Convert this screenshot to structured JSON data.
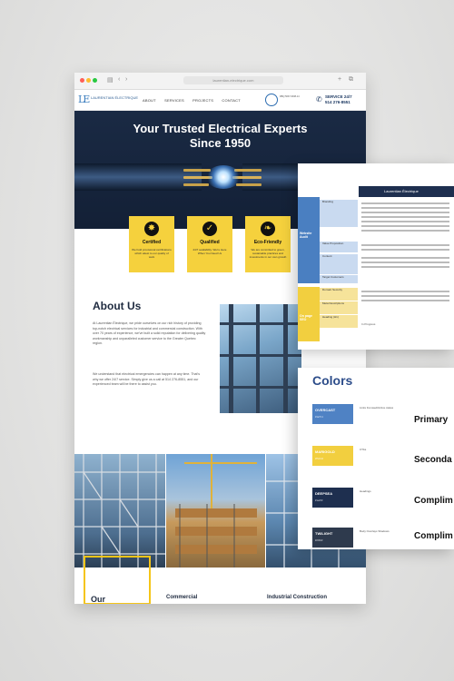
{
  "browser": {
    "url": "laurentian-electrique.com",
    "nav_icons": [
      "sidebar-icon",
      "back-icon",
      "forward-icon",
      "share-icon",
      "new-tab-icon",
      "tabs-icon"
    ]
  },
  "site": {
    "logo_mark": "LE",
    "logo_text_1": "LAURENTIAN ÉLECTRIQUE",
    "logo_text_2": "",
    "nav": [
      "ABOUT",
      "SERVICES",
      "PROJECTS",
      "CONTACT"
    ],
    "badge_text": "RBQ 5637-6038-14",
    "service_label": "SERVICE 24/7",
    "phone": "514 276-8551"
  },
  "hero": {
    "title_1": "Your Trusted Electrical Experts",
    "title_2": "Since 1950"
  },
  "features": [
    {
      "icon": "certified-icon",
      "glyph": "✸",
      "title": "Certified",
      "desc": "We hold provisional certifications which attest to our quality of work"
    },
    {
      "icon": "check-icon",
      "glyph": "✓",
      "title": "Qualified",
      "desc": "24/7 availability. We're Here When You Need Us"
    },
    {
      "icon": "leaf-icon",
      "glyph": "❧",
      "title": "Eco-Friendly",
      "desc": "We are committed to green, sustainable practices and investments in our own growth"
    }
  ],
  "about": {
    "heading": "About Us",
    "p1": "At Laurentian Électrique, we pride ourselves on our rich history of providing top-notch electrical services for industrial and commercial construction. With over 70 years of experience, we've built a solid reputation for delivering quality workmanship and unparalleled customer service to the Greater Quebec region.",
    "p2": "We understand that electrical emergencies can happen at any time. That's why we offer 24/7 service. Simply give us a call at 514 276-8551, and our experienced team will be there to assist you."
  },
  "gallery": {
    "captions": [
      "Our",
      "Commercial",
      "Industrial Construction"
    ]
  },
  "doc1": {
    "header": "Laurentian Électrique",
    "group_label_1": "Website Audit",
    "group_label_2": "On page SEO",
    "rows": [
      "Branding",
      "Value Proposition",
      "Content",
      "Target Customers",
      "Domain Security",
      "Meta Descriptions",
      "Heading (H1)"
    ],
    "last_note": "In Progress"
  },
  "doc2": {
    "title": "Colors",
    "swatches": [
      {
        "name": "OVERCAST",
        "value": "#4a7fc1",
        "color": "#4f82c4",
        "role": "Links\nFocused/Active states",
        "label": "Primary"
      },
      {
        "name": "MARIGOLD",
        "value": "#f5d13d",
        "color": "#f2cf3f",
        "role": "CTAs",
        "label": "Seconda"
      },
      {
        "name": "DEEPSEA",
        "value": "#1e2f4f",
        "color": "#1e2f4f",
        "role": "Headings",
        "label": "Complim"
      },
      {
        "name": "TWILIGHT",
        "value": "#2f3b4f",
        "color": "#2e3a4d",
        "role": "Body\nOverlays\nShadows",
        "label": "Complim"
      }
    ]
  }
}
